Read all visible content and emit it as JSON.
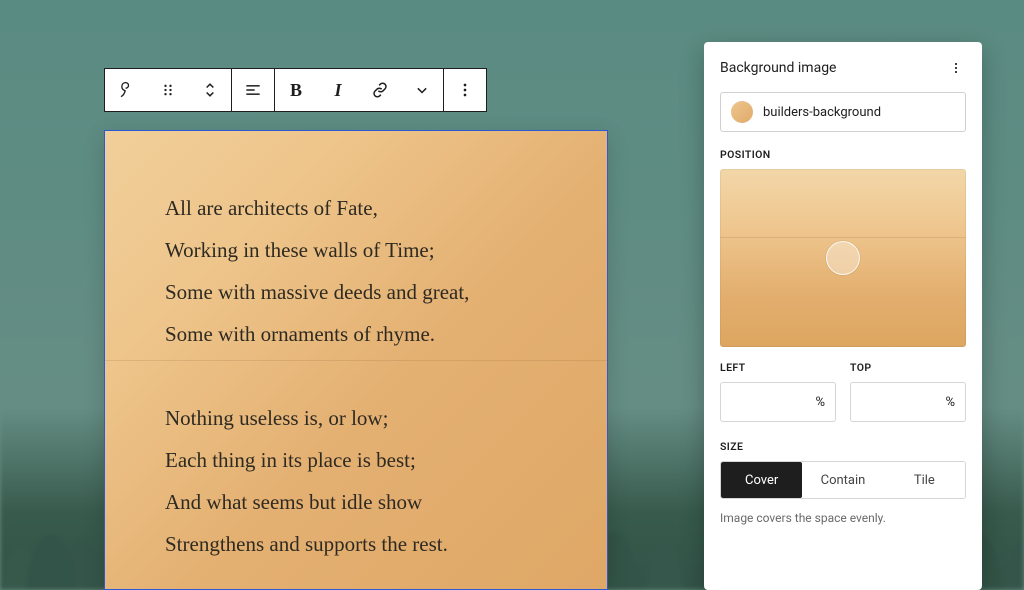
{
  "poem": {
    "stanza1": [
      "All are architects of Fate,",
      "Working in these walls of Time;",
      "Some with massive deeds and great,",
      "Some with ornaments of rhyme."
    ],
    "stanza2": [
      "Nothing useless is, or low;",
      "Each thing in its place is best;",
      "And what seems but idle show",
      "Strengthens and supports the rest."
    ]
  },
  "toolbar": {
    "bold": "B",
    "italic": "I"
  },
  "panel": {
    "title": "Background image",
    "image_name": "builders-background",
    "position_label": "POSITION",
    "left_label": "LEFT",
    "top_label": "TOP",
    "left_value": "",
    "top_value": "",
    "unit": "%",
    "size_label": "SIZE",
    "size_options": {
      "cover": "Cover",
      "contain": "Contain",
      "tile": "Tile"
    },
    "size_selected": "cover",
    "help_text": "Image covers the space evenly.",
    "swatch_color": "#e6b679"
  }
}
